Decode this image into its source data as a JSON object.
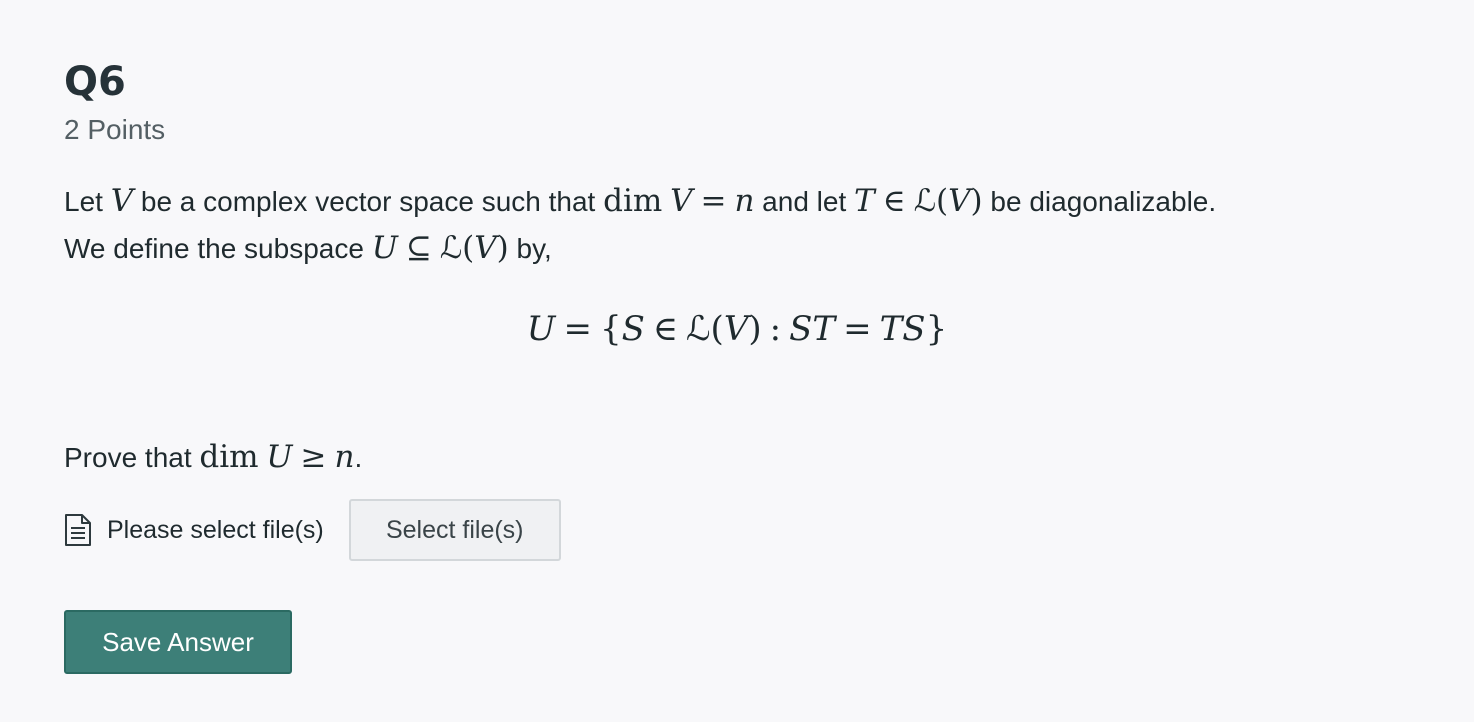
{
  "question": {
    "title": "Q6",
    "points": "2 Points",
    "prompt": {
      "t1": "Let ",
      "m_V1": "V",
      "t2": " be a complex vector space such that ",
      "m_dim1": "dim",
      "m_V2": "V",
      "m_eq1": "=",
      "m_n1": "n",
      "t3": " and let ",
      "m_T1": "T",
      "m_in1": "∈",
      "m_L1": "ℒ",
      "m_lp1": "(",
      "m_V3": "V",
      "m_rp1": ")",
      "t4": " be diagonalizable.",
      "t5": "We define the subspace ",
      "m_U1": "U",
      "m_subseteq": "⊆",
      "m_L2": "ℒ",
      "m_lp2": "(",
      "m_V4": "V",
      "m_rp2": ")",
      "t6": " by,"
    },
    "display": {
      "U": "U",
      "eq": "=",
      "lbrace": "{",
      "S": "S",
      "in": "∈",
      "L": "ℒ",
      "lp": "(",
      "V": "V",
      "rp": ")",
      "colon": ":",
      "ST": "ST",
      "eq2": "=",
      "TS": "TS",
      "rbrace": "}"
    },
    "prove": {
      "t1": "Prove that ",
      "dim": "dim",
      "U": "U",
      "geq": "≥",
      "n": "n",
      "t2": "."
    }
  },
  "upload": {
    "icon": "document-icon",
    "label": "Please select file(s)",
    "button_label": "Select file(s)"
  },
  "actions": {
    "save_label": "Save Answer",
    "save_color": "#3d7f78"
  }
}
